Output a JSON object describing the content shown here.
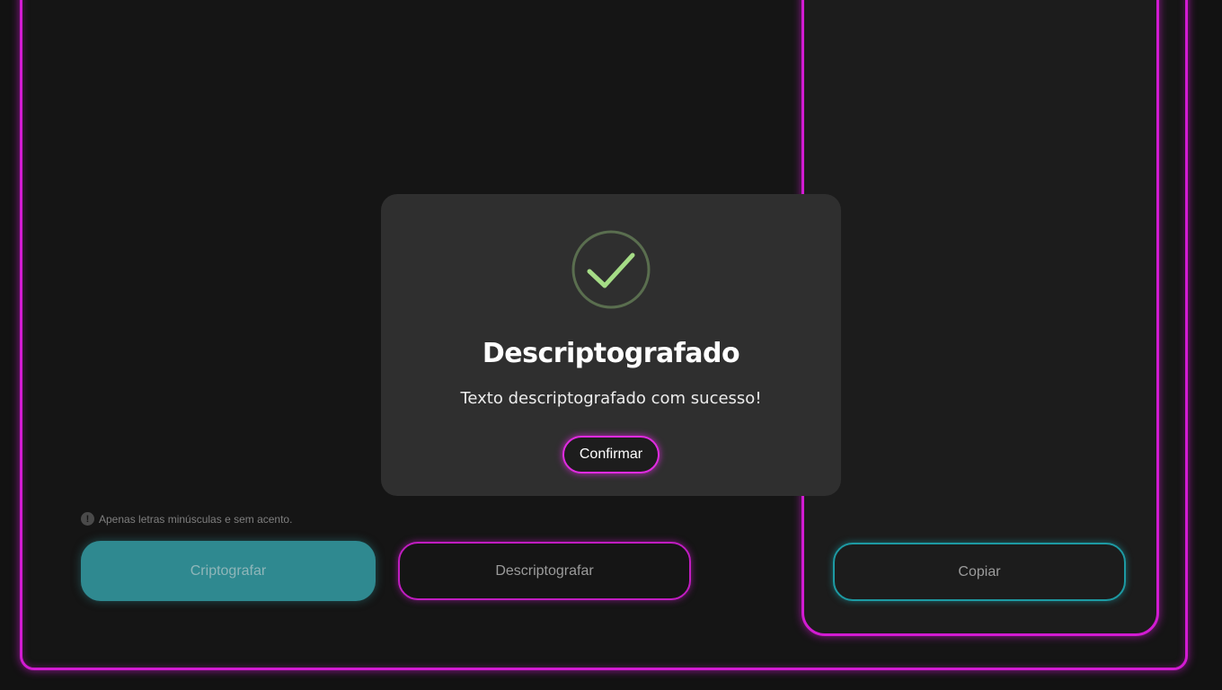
{
  "app": {
    "hint_icon": "info-icon",
    "hint_text": "Apenas letras minúsculas e sem acento.",
    "encrypt_label": "Criptografar",
    "decrypt_label": "Descriptografar",
    "copy_label": "Copiar",
    "accent_color": "#d21bd2",
    "teal_color": "#2f8990"
  },
  "modal": {
    "icon": "check-circle-icon",
    "title": "Descriptografado",
    "text": "Texto descriptografado com sucesso!",
    "confirm_label": "Confirmar",
    "icon_color": "#a5dc86"
  }
}
